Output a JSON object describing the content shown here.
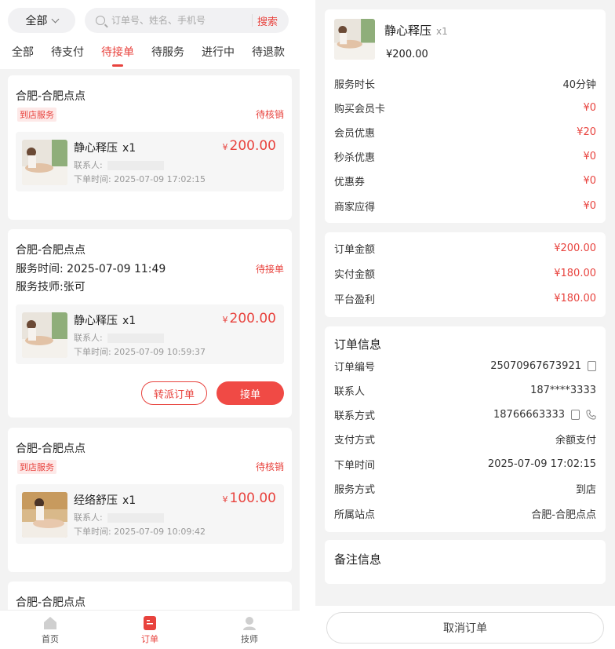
{
  "list": {
    "filter_label": "全部",
    "search_placeholder": "订单号、姓名、手机号",
    "search_button": "搜索",
    "tabs": [
      "全部",
      "待支付",
      "待接单",
      "待服务",
      "进行中",
      "待退款"
    ],
    "active_tab": "待接单",
    "orders": [
      {
        "store": "合肥-合肥点点",
        "tag": "到店服务",
        "status": "待核销",
        "item_name": "静心释压",
        "qty": "x1",
        "currency": "¥",
        "price": "200.00",
        "contact_label": "联系人:",
        "time_label": "下单时间:",
        "order_time": "2025-07-09 17:02:15"
      },
      {
        "store": "合肥-合肥点点",
        "service_time_label": "服务时间:",
        "service_time": "2025-07-09 11:49",
        "status": "待接单",
        "tech_label": "服务技师:",
        "tech": "张可",
        "item_name": "静心释压",
        "qty": "x1",
        "currency": "¥",
        "price": "200.00",
        "contact_label": "联系人:",
        "time_label": "下单时间:",
        "order_time": "2025-07-09 10:59:37",
        "transfer_button": "转派订单",
        "accept_button": "接单"
      },
      {
        "store": "合肥-合肥点点",
        "tag": "到店服务",
        "status": "待核销",
        "item_name": "经络舒压",
        "qty": "x1",
        "currency": "¥",
        "price": "100.00",
        "contact_label": "联系人:",
        "time_label": "下单时间:",
        "order_time": "2025-07-09 10:09:42"
      },
      {
        "store": "合肥-合肥点点"
      }
    ],
    "nav": [
      {
        "label": "首页",
        "icon": "home-icon"
      },
      {
        "label": "订单",
        "icon": "order-icon"
      },
      {
        "label": "技师",
        "icon": "technician-icon"
      }
    ]
  },
  "detail": {
    "item_name": "静心释压",
    "qty": "x1",
    "price": "¥200.00",
    "fees": [
      {
        "label": "服务时长",
        "value": "40分钟"
      },
      {
        "label": "购买会员卡",
        "value": "¥0"
      },
      {
        "label": "会员优惠",
        "value": "¥20"
      },
      {
        "label": "秒杀优惠",
        "value": "¥0"
      },
      {
        "label": "优惠券",
        "value": "¥0"
      },
      {
        "label": "商家应得",
        "value": "¥0"
      }
    ],
    "amounts": [
      {
        "label": "订单金额",
        "value": "¥200.00"
      },
      {
        "label": "实付金额",
        "value": "¥180.00"
      },
      {
        "label": "平台盈利",
        "value": "¥180.00"
      }
    ],
    "info_title": "订单信息",
    "info": [
      {
        "label": "订单编号",
        "value": "25070967673921"
      },
      {
        "label": "联系人",
        "value": "187****3333"
      },
      {
        "label": "联系方式",
        "value": "18766663333"
      },
      {
        "label": "支付方式",
        "value": "余额支付"
      },
      {
        "label": "下单时间",
        "value": "2025-07-09 17:02:15"
      },
      {
        "label": "服务方式",
        "value": "到店"
      },
      {
        "label": "所属站点",
        "value": "合肥-合肥点点"
      }
    ],
    "remark_title": "备注信息",
    "cancel_button": "取消订单"
  },
  "colors": {
    "accent": "#e8433e",
    "background": "#f3f3f3"
  }
}
